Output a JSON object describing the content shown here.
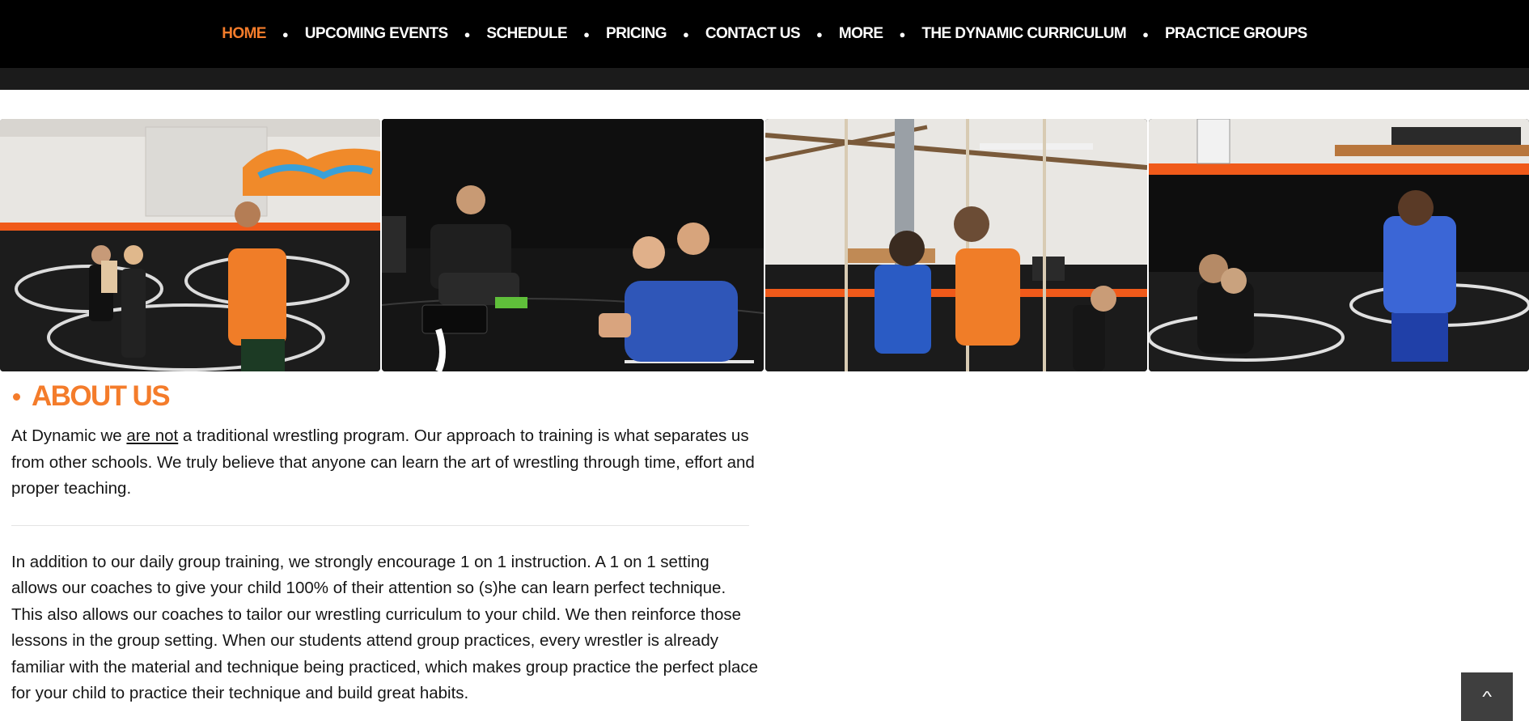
{
  "nav": {
    "items": [
      {
        "label": "HOME",
        "active": true
      },
      {
        "label": "UPCOMING EVENTS",
        "active": false
      },
      {
        "label": "SCHEDULE",
        "active": false
      },
      {
        "label": "PRICING",
        "active": false
      },
      {
        "label": "CONTACT US",
        "active": false
      },
      {
        "label": "MORE",
        "active": false
      },
      {
        "label": "THE DYNAMIC CURRICULUM",
        "active": false
      },
      {
        "label": "PRACTICE GROUPS",
        "active": false
      }
    ],
    "separator": "●"
  },
  "gallery": {
    "photos": [
      "wrestling-coach-photo",
      "wrestling-drill-photo",
      "wrestling-students-photo",
      "wrestling-partner-drill-photo"
    ]
  },
  "about": {
    "title": "ABOUT US",
    "p1_before": "At Dynamic we ",
    "p1_underlined": "are not",
    "p1_after": " a traditional wrestling program. Our approach to training is what separates us from other schools. We truly believe that anyone can learn the art of wrestling through time, effort and proper teaching.",
    "p2": "In addition to our daily group training, we strongly encourage 1 on 1 instruction. A 1 on 1 setting allows our coaches to give your child 100% of their attention so (s)he can learn perfect technique. This also allows our coaches to tailor our wrestling curriculum to your child. We then reinforce those lessons in the group setting. When our students attend group practices, every wrestler is already familiar with the material and technique being practiced, which makes group practice the perfect place for your child to practice their technique and build great habits."
  },
  "back_to_top": {
    "icon": "chevron-up-icon",
    "glyph": "^"
  },
  "colors": {
    "accent": "#f47c2b",
    "nav_bg": "#000000",
    "subbar_bg": "#1b1b1b"
  }
}
